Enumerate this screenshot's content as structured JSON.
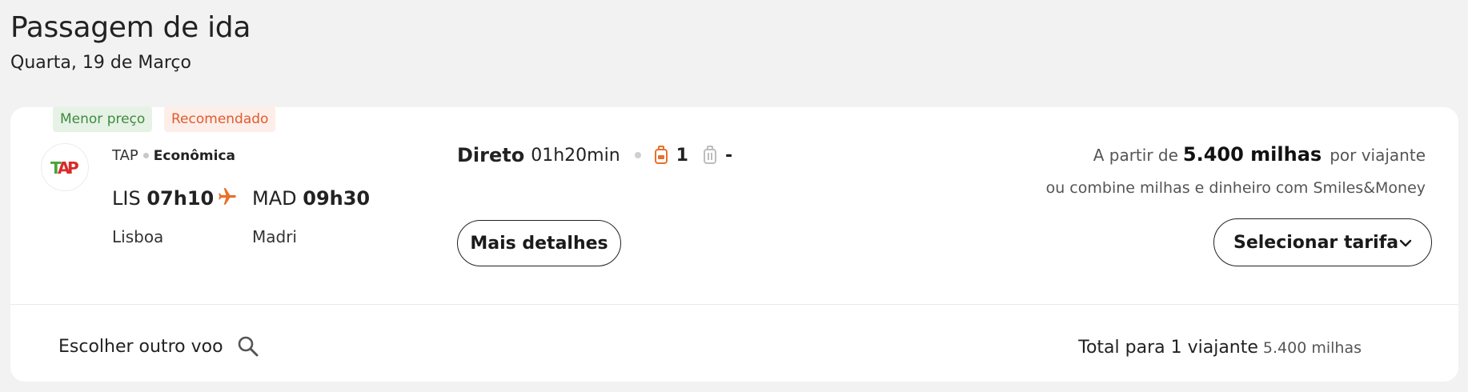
{
  "header": {
    "title": "Passagem de ida",
    "date": "Quarta, 19 de Março"
  },
  "flight": {
    "badges": {
      "lowest_price": "Menor preço",
      "recommended": "Recomendado"
    },
    "logo_text": "TAP",
    "airline": "TAP",
    "cabin": "Econômica",
    "origin_code": "LIS",
    "departure_time": "07h10",
    "destination_code": "MAD",
    "arrival_time": "09h30",
    "origin_city": "Lisboa",
    "destination_city": "Madri",
    "stop_type": "Direto",
    "duration": "01h20min",
    "carry_on_count": "1",
    "checked_bag": "-",
    "details_label": "Mais detalhes",
    "price_prefix": "A partir de",
    "price_miles": "5.400 milhas",
    "price_suffix": "por viajante",
    "combine_text": "ou combine milhas e dinheiro com Smiles&Money",
    "select_label": "Selecionar tarifa"
  },
  "footer": {
    "other_flight_label": "Escolher outro voo",
    "total_label": "Total para 1 viajante",
    "total_miles": "5.400 milhas"
  },
  "colors": {
    "accent": "#e8702a",
    "badge_green_text": "#3f8b3f",
    "badge_orange_text": "#e05c2b",
    "tap_red": "#d92a2a",
    "tap_green": "#4aa33a"
  },
  "icons": [
    "plane-icon",
    "carry-on-bag-icon",
    "checked-bag-icon",
    "chevron-down-icon",
    "search-icon"
  ]
}
